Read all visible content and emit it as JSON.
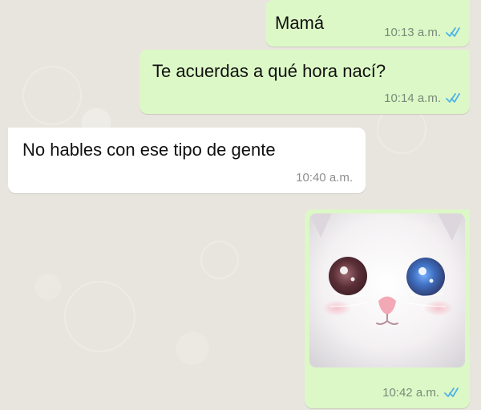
{
  "messages": [
    {
      "direction": "outgoing",
      "text": "Mamá",
      "time": "10:13 a.m.",
      "status_icon": "double-check-icon",
      "status_color": "#4fb3e8"
    },
    {
      "direction": "outgoing",
      "text": "Te acuerdas a qué hora nací?",
      "time": "10:14 a.m.",
      "status_icon": "double-check-icon",
      "status_color": "#4fb3e8"
    },
    {
      "direction": "incoming",
      "text": "No hables con ese tipo de gente",
      "time": "10:40 a.m."
    },
    {
      "direction": "outgoing",
      "type": "image",
      "image_icon": "kitten-sticker-icon",
      "time": "10:42 a.m.",
      "status_icon": "double-check-icon",
      "status_color": "#4fb3e8"
    }
  ],
  "theme": {
    "outgoing_bubble": "#dcf8c6",
    "incoming_bubble": "#ffffff",
    "background": "#e8e5de",
    "read_receipt": "#4fb3e8"
  }
}
